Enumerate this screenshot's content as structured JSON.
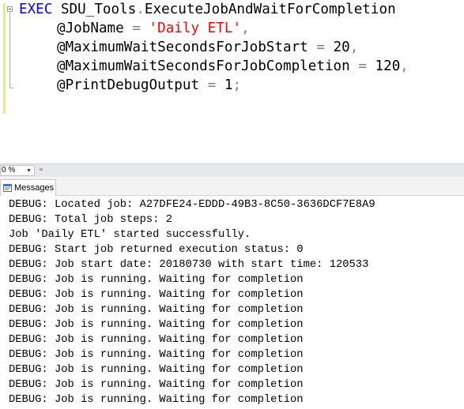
{
  "editor": {
    "lines": [
      {
        "parts": [
          {
            "cls": "kw",
            "text": "EXEC"
          },
          {
            "cls": "id",
            "text": " SDU_Tools"
          },
          {
            "cls": "op",
            "text": "."
          },
          {
            "cls": "id",
            "text": "ExecuteJobAndWaitForCompletion"
          }
        ]
      },
      {
        "parts": [
          {
            "cls": "id",
            "text": "@JobName"
          },
          {
            "cls": "op",
            "text": " = "
          },
          {
            "cls": "str",
            "text": "'Daily ETL'"
          },
          {
            "cls": "op",
            "text": ","
          }
        ]
      },
      {
        "parts": [
          {
            "cls": "id",
            "text": "@MaximumWaitSecondsForJobStart"
          },
          {
            "cls": "op",
            "text": " = "
          },
          {
            "cls": "id",
            "text": "20"
          },
          {
            "cls": "op",
            "text": ","
          }
        ]
      },
      {
        "parts": [
          {
            "cls": "id",
            "text": "@MaximumWaitSecondsForJobCompletion"
          },
          {
            "cls": "op",
            "text": " = "
          },
          {
            "cls": "id",
            "text": "120"
          },
          {
            "cls": "op",
            "text": ","
          }
        ]
      },
      {
        "parts": [
          {
            "cls": "id",
            "text": "@PrintDebugOutput"
          },
          {
            "cls": "op",
            "text": " = "
          },
          {
            "cls": "id",
            "text": "1"
          },
          {
            "cls": "op",
            "text": ";"
          }
        ]
      }
    ]
  },
  "zoom": {
    "value": "0 %"
  },
  "results": {
    "tab_label": "Messages"
  },
  "messages": [
    "DEBUG: Located job: A27DFE24-EDDD-49B3-8C50-3636DCF7E8A9",
    "DEBUG: Total job steps: 2",
    "Job 'Daily ETL' started successfully.",
    "DEBUG: Start job returned execution status: 0",
    "DEBUG: Job start date: 20180730 with start time: 120533",
    "DEBUG: Job is running. Waiting for completion",
    "DEBUG: Job is running. Waiting for completion",
    "DEBUG: Job is running. Waiting for completion",
    "DEBUG: Job is running. Waiting for completion",
    "DEBUG: Job is running. Waiting for completion",
    "DEBUG: Job is running. Waiting for completion",
    "DEBUG: Job is running. Waiting for completion",
    "DEBUG: Job is running. Waiting for completion",
    "DEBUG: Job is running. Waiting for completion"
  ]
}
